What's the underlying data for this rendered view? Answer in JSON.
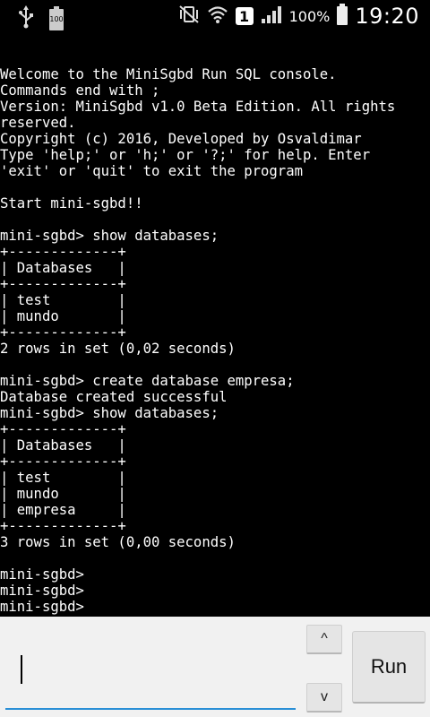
{
  "status_bar": {
    "battery_small_label": "100",
    "sim_slot": "1",
    "battery_percent": "100%",
    "time": "19:20"
  },
  "console": {
    "lines": [
      "Welcome to the MiniSgbd Run SQL console.",
      "Commands end with ;",
      "Version: MiniSgbd v1.0 Beta Edition. All rights",
      "reserved.",
      "Copyright (c) 2016, Developed by Osvaldimar",
      "Type 'help;' or 'h;' or '?;' for help. Enter",
      "'exit' or 'quit' to exit the program",
      "",
      "Start mini-sgbd!!",
      "",
      "mini-sgbd> show databases;",
      "+-------------+",
      "| Databases   |",
      "+-------------+",
      "| test        |",
      "| mundo       |",
      "+-------------+",
      "2 rows in set (0,02 seconds)",
      "",
      "mini-sgbd> create database empresa;",
      "Database created successful",
      "mini-sgbd> show databases;",
      "+-------------+",
      "| Databases   |",
      "+-------------+",
      "| test        |",
      "| mundo       |",
      "| empresa     |",
      "+-------------+",
      "3 rows in set (0,00 seconds)",
      "",
      "mini-sgbd>",
      "mini-sgbd>",
      "mini-sgbd>"
    ]
  },
  "controls": {
    "input_value": "",
    "up_label": "^",
    "down_label": "v",
    "run_label": "Run"
  },
  "colors": {
    "console_bg": "#000000",
    "console_text": "#ffffff",
    "accent": "#2a8fd6"
  }
}
